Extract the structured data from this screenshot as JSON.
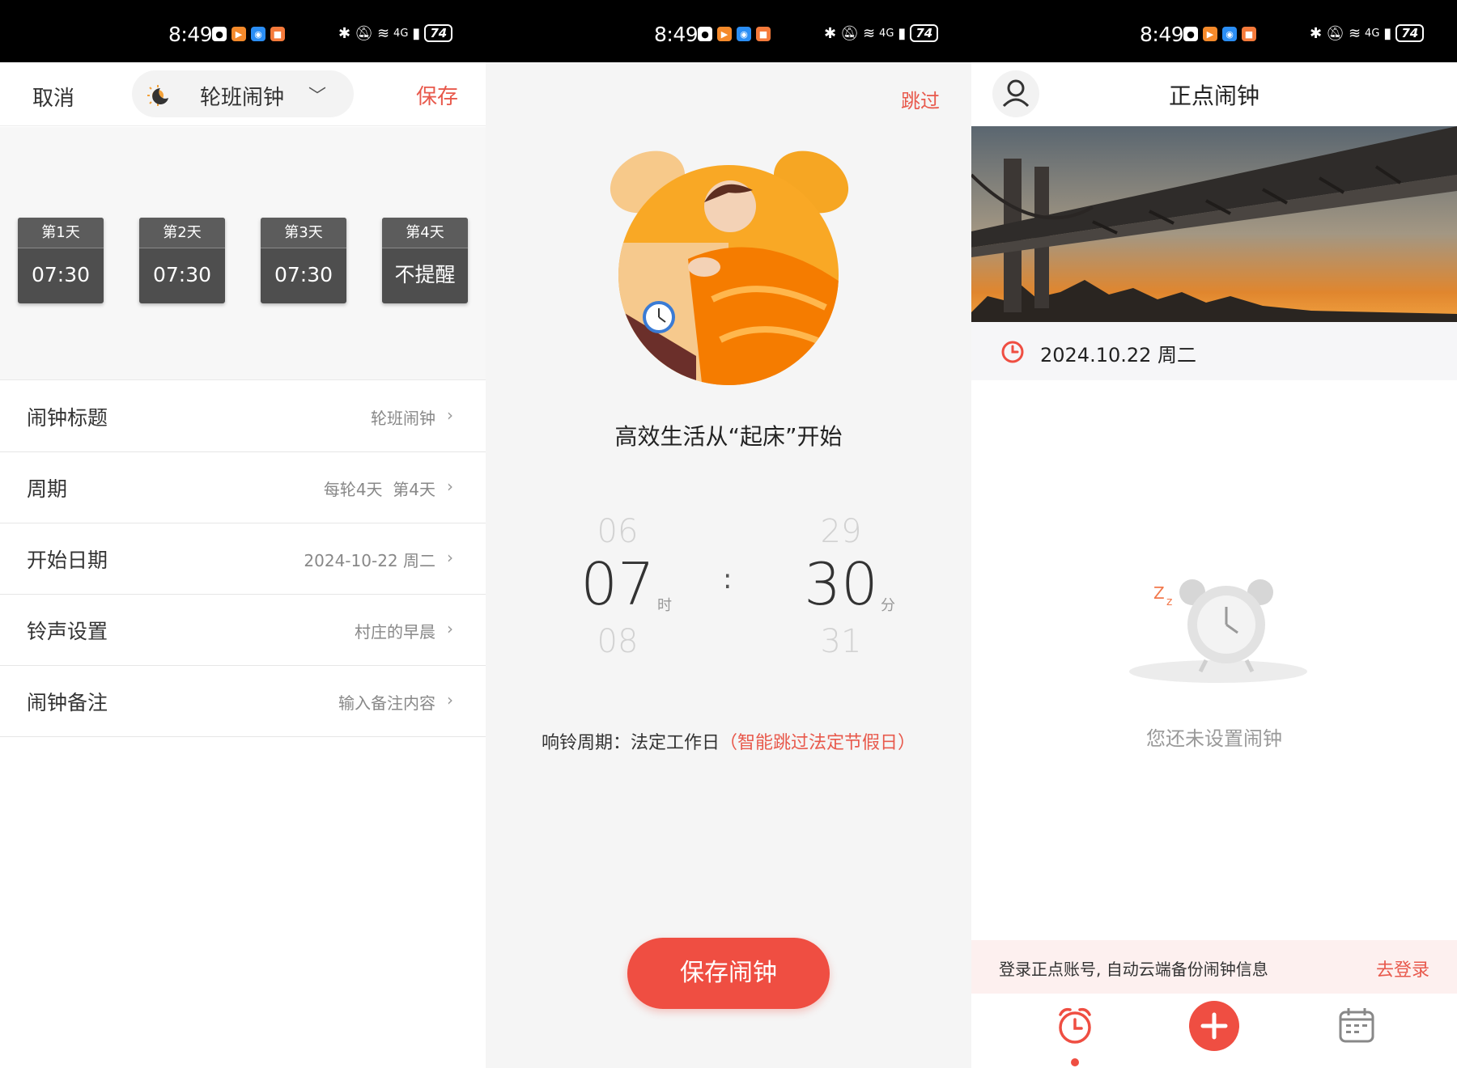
{
  "status_bar": {
    "time": "8:49",
    "network": "4G",
    "battery": "74"
  },
  "edit_screen": {
    "cancel_label": "取消",
    "title_selector": "轮班闹钟",
    "save_label": "保存",
    "days": [
      {
        "label": "第1天",
        "value": "07:30"
      },
      {
        "label": "第2天",
        "value": "07:30"
      },
      {
        "label": "第3天",
        "value": "07:30"
      },
      {
        "label": "第4天",
        "value": "不提醒"
      }
    ],
    "settings": [
      {
        "label": "闹钟标题",
        "value": "轮班闹钟"
      },
      {
        "label": "周期",
        "value": "每轮4天  第4天"
      },
      {
        "label": "开始日期",
        "value": "2024-10-22 周二"
      },
      {
        "label": "铃声设置",
        "value": "村庄的早晨"
      },
      {
        "label": "闹钟备注",
        "value": "输入备注内容"
      }
    ]
  },
  "wake_screen": {
    "skip_label": "跳过",
    "slogan": "高效生活从“起床”开始",
    "hour_prev": "06",
    "hour": "07",
    "hour_next": "08",
    "hour_unit": "时",
    "minute_prev": "29",
    "minute": "30",
    "minute_next": "31",
    "minute_unit": "分",
    "cycle_prefix": "响铃周期：法定工作日",
    "cycle_note": "（智能跳过法定节假日）",
    "save_button": "保存闹钟"
  },
  "home_screen": {
    "title": "正点闹钟",
    "date": "2024.10.22 周二",
    "empty_text": "您还未设置闹钟",
    "login_prompt": "登录正点账号, 自动云端备份闹钟信息",
    "login_link": "去登录",
    "tabs": [
      "alarm-clock-icon",
      "add-icon",
      "calendar-icon"
    ]
  },
  "colors": {
    "accent": "#EF4E42",
    "link_red": "#E8594C",
    "day_tile": "#4E4E4E"
  }
}
